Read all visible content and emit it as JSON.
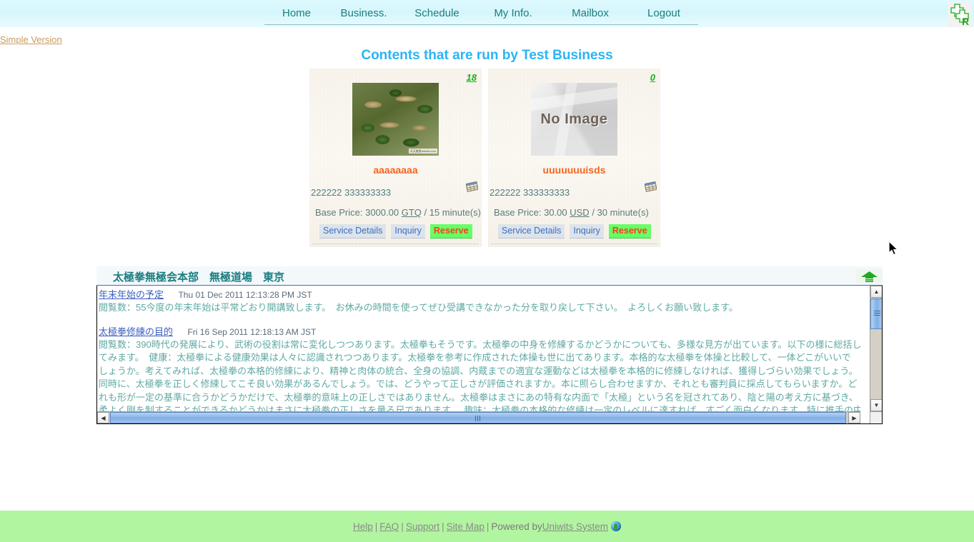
{
  "header": {
    "nav": [
      {
        "label": "Home",
        "name": "nav-home"
      },
      {
        "label": "Business.",
        "name": "nav-business"
      },
      {
        "label": "Schedule",
        "name": "nav-schedule"
      },
      {
        "label": "My Info.",
        "name": "nav-myinfo"
      },
      {
        "label": "Mailbox",
        "name": "nav-mailbox"
      },
      {
        "label": "Logout",
        "name": "nav-logout"
      }
    ],
    "logo_alt": "uniwits-logo-icon",
    "nav_color": "#1a7d80",
    "background": "#ddfaff"
  },
  "simple_version_link": "Simple Version",
  "page_title": "Contents that are run by Test Business",
  "page_title_color": "#2ab4f5",
  "cards": [
    {
      "count": "18",
      "image_type": "food-photo",
      "image_watermark": "天天美食meishi.com",
      "name": "aaaaaaaa",
      "code": "222222 333333333",
      "calendar_icon": "calendar-icon",
      "price_prefix": "Base Price: 3000.00",
      "currency": "GTQ",
      "duration": "/ 15 minute(s)",
      "buttons": {
        "details": "Service Details",
        "inquiry": "Inquiry",
        "reserve": "Reserve"
      }
    },
    {
      "count": "0",
      "image_type": "no-image",
      "image_text": "No Image",
      "name": "uuuuuuuisds",
      "code": "222222 333333333",
      "calendar_icon": "calendar-icon",
      "price_prefix": "Base Price: 30.00",
      "currency": "USD",
      "duration": "/ 30 minute(s)",
      "buttons": {
        "details": "Service Details",
        "inquiry": "Inquiry",
        "reserve": "Reserve"
      }
    }
  ],
  "card_name_color": "#f26522",
  "reserve_bg": "#66ff66",
  "reserve_fg": "#ff3b18",
  "panel": {
    "title": "太極拳無極会本部　無極道場　東京",
    "collapse_icon": "collapse-up-arrow-icon",
    "expand_icon": "expand-down-arrow-icon",
    "articles": [
      {
        "title": "年末年始の予定",
        "date": "Thu 01 Dec 2011 12:13:28 PM JST",
        "lines": [
          "閲覧数：55今度の年末年始は平常どおり開講致します。　お休みの時間を使ってぜひ受講できなかった分を取り戻して下さい。　よろしくお願い致します。"
        ]
      },
      {
        "title": "太極拳修練の目的",
        "date": "Fri 16 Sep 2011 12:18:13 AM JST",
        "lines": [
          "閲覧数：390時代の発展により、武術の役割は常に変化しつつあります。太極拳もそうです。太極拳の中身を修練するかどうかについても、多様な見方が出ています。以下の様に総括し",
          "てみます。　健康：太極拳による健康効果は人々に認識されつつあります。太極拳を参考に作成された体操も世に出てあります。本格的な太極拳を体操と比較して、一体どこがいいで",
          "しょうか。考えてみれば、太極拳の本格的修練により、精神と肉体の統合、全身の協調、内蔵までの適宜な運動などは太極拳を本格的に修練しなければ、獲得しづらい効果でしょう。",
          "同時に、太極拳を正しく修練してこそ良い効果があるんでしょう。では、どうやって正しさが評価されますか。本に照らし合わせますか、それとも審判員に採点してもらいますか。ど",
          "れも形が一定の基準に合うかどうかだけで、太極拳的意味上の正しさではありません。太極拳はまさにあの特有な内面で「太極」という名を冠されてあり、陰と陽の考え方に基づき、",
          "柔よく剛を制することができるかどうかはまさに太極拳の正しさを量る尺であります。　趣味：太極拳の本格的な修練は一定のレベルに達すれば、すごく面白くなります。特に推手の中に"
        ]
      }
    ],
    "scroll": {
      "up_arrow": "▲",
      "down_arrow": "▼",
      "left_arrow": "◀",
      "right_arrow": "▶"
    }
  },
  "footer": {
    "links": [
      "Help",
      "FAQ",
      "Support",
      "Site Map"
    ],
    "powered_by_label": "Powered by",
    "powered_by_link": "Uniwits System",
    "globe_icon": "globe-icon",
    "separator": "|",
    "background": "#b2f5a0"
  }
}
